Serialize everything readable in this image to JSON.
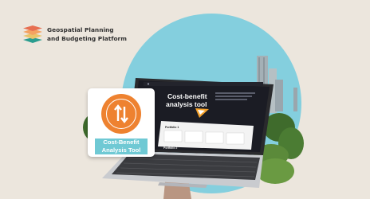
{
  "brand": {
    "line1": "Geospatial Planning",
    "line2": "and Budgeting Platform"
  },
  "laptop_screen": {
    "title_line1": "Cost-benefit",
    "title_line2": "analysis tool",
    "card1_label": "Portfolio 1",
    "card2_label": "Portfolio 2"
  },
  "badge": {
    "line1": "Cost-Benefit",
    "line2": "Analysis Tool"
  },
  "colors": {
    "background": "#ece6dd",
    "sky": "#84cfde",
    "accent_orange": "#ee8230",
    "label_teal": "#6fc9d4"
  }
}
